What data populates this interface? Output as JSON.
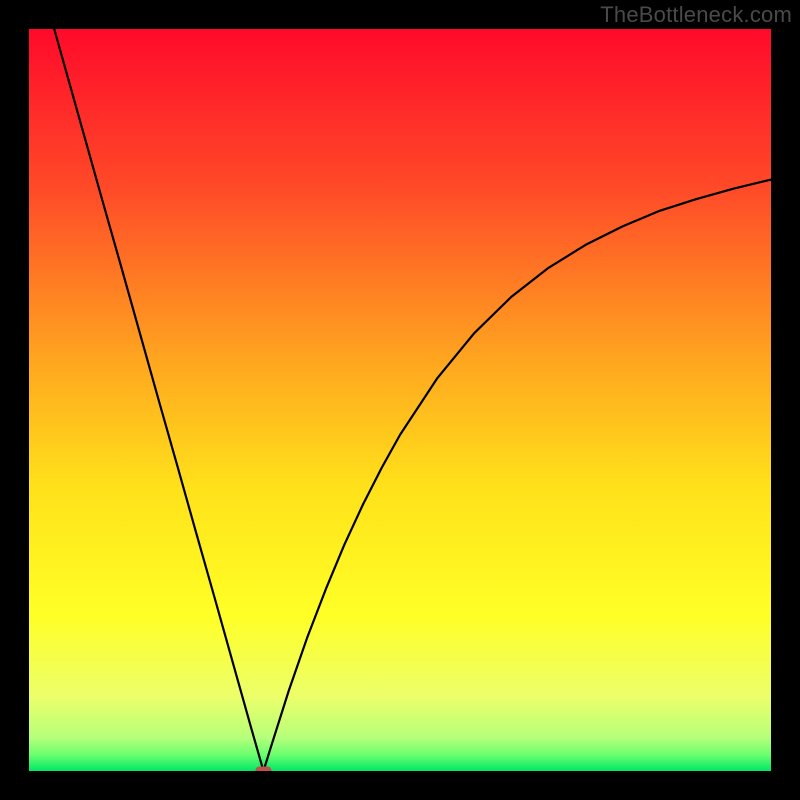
{
  "watermark": "TheBottleneck.com",
  "chart_data": {
    "type": "line",
    "title": "",
    "xlabel": "",
    "ylabel": "",
    "xlim": [
      0,
      100
    ],
    "ylim": [
      0,
      100
    ],
    "curve": {
      "x": [
        0.0,
        2.5,
        5.0,
        7.5,
        10.0,
        12.5,
        15.0,
        17.5,
        20.0,
        22.5,
        25.0,
        27.5,
        30.0,
        31.0,
        31.6,
        32.5,
        35.0,
        37.5,
        40.0,
        42.5,
        45.0,
        47.5,
        50.0,
        55.0,
        60.0,
        65.0,
        70.0,
        75.0,
        80.0,
        85.0,
        90.0,
        95.0,
        100.0
      ],
      "y": [
        112.0,
        103.2,
        94.3,
        85.4,
        76.5,
        67.7,
        58.8,
        49.9,
        41.1,
        32.2,
        23.4,
        14.5,
        5.6,
        2.1,
        0.0,
        2.9,
        10.8,
        18.0,
        24.5,
        30.5,
        35.9,
        40.8,
        45.3,
        52.9,
        59.0,
        63.9,
        67.8,
        70.9,
        73.4,
        75.5,
        77.1,
        78.5,
        79.7
      ]
    },
    "minimum_marker": {
      "x": 31.6,
      "y": 0.0,
      "color": "#c0504d"
    },
    "gradient_stops": [
      {
        "offset": 0.0,
        "color": "#ff0a2a"
      },
      {
        "offset": 0.22,
        "color": "#ff4c28"
      },
      {
        "offset": 0.45,
        "color": "#ffa71f"
      },
      {
        "offset": 0.62,
        "color": "#ffe21a"
      },
      {
        "offset": 0.79,
        "color": "#ffff26"
      },
      {
        "offset": 0.9,
        "color": "#ecff6a"
      },
      {
        "offset": 0.955,
        "color": "#b6ff7a"
      },
      {
        "offset": 0.978,
        "color": "#6bff70"
      },
      {
        "offset": 1.0,
        "color": "#00e765"
      }
    ]
  }
}
